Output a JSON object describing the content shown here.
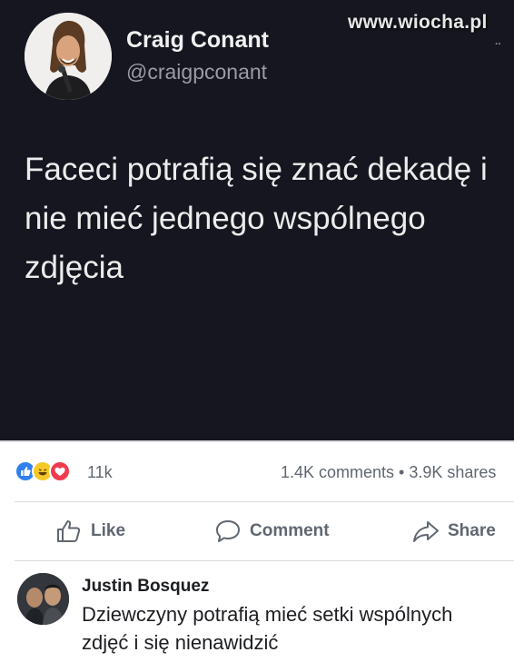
{
  "watermark": {
    "site": "www.wiocha.pl",
    "dots": ".."
  },
  "post": {
    "author": {
      "name": "Craig Conant",
      "handle": "@craigpconant"
    },
    "text": "Faceci potrafią się znać dekadę i nie mieć jednego wspólnego zdjęcia"
  },
  "stats": {
    "reaction_icons": [
      "like-reaction-icon",
      "haha-reaction-icon",
      "love-reaction-icon"
    ],
    "reaction_count": "11k",
    "comments_shares": "1.4K comments • 3.9K shares"
  },
  "actions": {
    "like_label": "Like",
    "comment_label": "Comment",
    "share_label": "Share"
  },
  "comment": {
    "author": "Justin Bosquez",
    "text": "Dziewczyny potrafią mieć setki wspólnych zdjęć i się nienawidzić"
  },
  "colors": {
    "tweet_background": "#15161f",
    "like_blue": "#2f80ed",
    "haha_yellow": "#f7c928",
    "love_red": "#ef3b4f",
    "secondary_text": "#606770"
  }
}
